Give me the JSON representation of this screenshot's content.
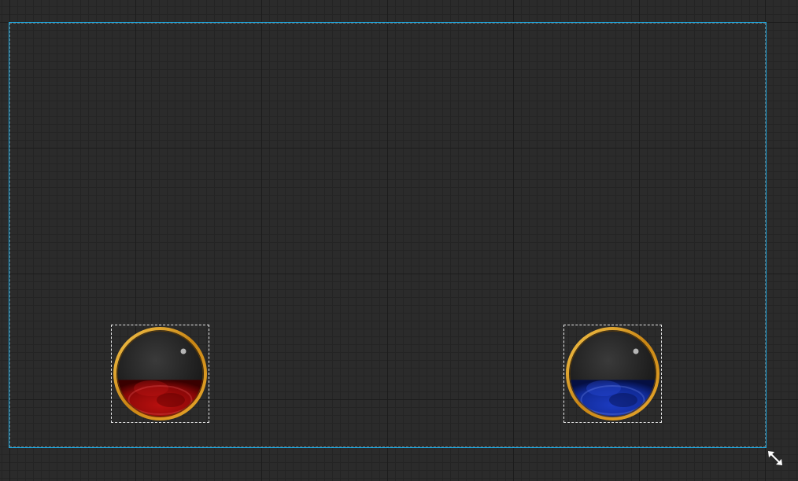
{
  "canvas": {
    "frame_color": "#1aa7e0",
    "background_color": "#2b2b2b"
  },
  "orbs": [
    {
      "name": "health",
      "liquid_color": "#a00a0a",
      "liquid_dark": "#4a0000",
      "rim_color": "#d99a1e",
      "fill_level": 0.43
    },
    {
      "name": "mana",
      "liquid_color": "#1530a8",
      "liquid_dark": "#05104a",
      "rim_color": "#d99a1e",
      "fill_level": 0.43
    }
  ],
  "icons": {
    "resize_handle": "resize-diagonal-icon"
  }
}
